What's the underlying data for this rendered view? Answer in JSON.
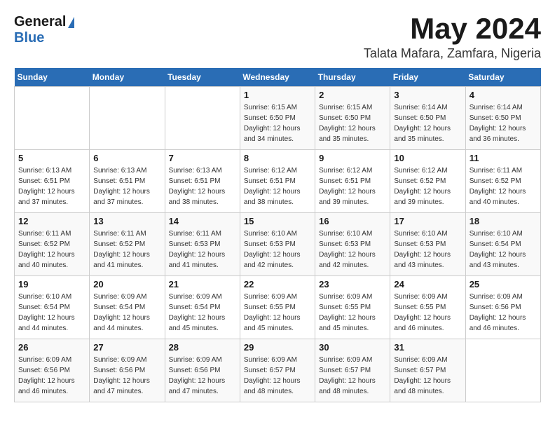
{
  "header": {
    "logo_general": "General",
    "logo_blue": "Blue",
    "month": "May 2024",
    "location": "Talata Mafara, Zamfara, Nigeria"
  },
  "days_of_week": [
    "Sunday",
    "Monday",
    "Tuesday",
    "Wednesday",
    "Thursday",
    "Friday",
    "Saturday"
  ],
  "weeks": [
    [
      {
        "day": "",
        "info": ""
      },
      {
        "day": "",
        "info": ""
      },
      {
        "day": "",
        "info": ""
      },
      {
        "day": "1",
        "info": "Sunrise: 6:15 AM\nSunset: 6:50 PM\nDaylight: 12 hours\nand 34 minutes."
      },
      {
        "day": "2",
        "info": "Sunrise: 6:15 AM\nSunset: 6:50 PM\nDaylight: 12 hours\nand 35 minutes."
      },
      {
        "day": "3",
        "info": "Sunrise: 6:14 AM\nSunset: 6:50 PM\nDaylight: 12 hours\nand 35 minutes."
      },
      {
        "day": "4",
        "info": "Sunrise: 6:14 AM\nSunset: 6:50 PM\nDaylight: 12 hours\nand 36 minutes."
      }
    ],
    [
      {
        "day": "5",
        "info": "Sunrise: 6:13 AM\nSunset: 6:51 PM\nDaylight: 12 hours\nand 37 minutes."
      },
      {
        "day": "6",
        "info": "Sunrise: 6:13 AM\nSunset: 6:51 PM\nDaylight: 12 hours\nand 37 minutes."
      },
      {
        "day": "7",
        "info": "Sunrise: 6:13 AM\nSunset: 6:51 PM\nDaylight: 12 hours\nand 38 minutes."
      },
      {
        "day": "8",
        "info": "Sunrise: 6:12 AM\nSunset: 6:51 PM\nDaylight: 12 hours\nand 38 minutes."
      },
      {
        "day": "9",
        "info": "Sunrise: 6:12 AM\nSunset: 6:51 PM\nDaylight: 12 hours\nand 39 minutes."
      },
      {
        "day": "10",
        "info": "Sunrise: 6:12 AM\nSunset: 6:52 PM\nDaylight: 12 hours\nand 39 minutes."
      },
      {
        "day": "11",
        "info": "Sunrise: 6:11 AM\nSunset: 6:52 PM\nDaylight: 12 hours\nand 40 minutes."
      }
    ],
    [
      {
        "day": "12",
        "info": "Sunrise: 6:11 AM\nSunset: 6:52 PM\nDaylight: 12 hours\nand 40 minutes."
      },
      {
        "day": "13",
        "info": "Sunrise: 6:11 AM\nSunset: 6:52 PM\nDaylight: 12 hours\nand 41 minutes."
      },
      {
        "day": "14",
        "info": "Sunrise: 6:11 AM\nSunset: 6:53 PM\nDaylight: 12 hours\nand 41 minutes."
      },
      {
        "day": "15",
        "info": "Sunrise: 6:10 AM\nSunset: 6:53 PM\nDaylight: 12 hours\nand 42 minutes."
      },
      {
        "day": "16",
        "info": "Sunrise: 6:10 AM\nSunset: 6:53 PM\nDaylight: 12 hours\nand 42 minutes."
      },
      {
        "day": "17",
        "info": "Sunrise: 6:10 AM\nSunset: 6:53 PM\nDaylight: 12 hours\nand 43 minutes."
      },
      {
        "day": "18",
        "info": "Sunrise: 6:10 AM\nSunset: 6:54 PM\nDaylight: 12 hours\nand 43 minutes."
      }
    ],
    [
      {
        "day": "19",
        "info": "Sunrise: 6:10 AM\nSunset: 6:54 PM\nDaylight: 12 hours\nand 44 minutes."
      },
      {
        "day": "20",
        "info": "Sunrise: 6:09 AM\nSunset: 6:54 PM\nDaylight: 12 hours\nand 44 minutes."
      },
      {
        "day": "21",
        "info": "Sunrise: 6:09 AM\nSunset: 6:54 PM\nDaylight: 12 hours\nand 45 minutes."
      },
      {
        "day": "22",
        "info": "Sunrise: 6:09 AM\nSunset: 6:55 PM\nDaylight: 12 hours\nand 45 minutes."
      },
      {
        "day": "23",
        "info": "Sunrise: 6:09 AM\nSunset: 6:55 PM\nDaylight: 12 hours\nand 45 minutes."
      },
      {
        "day": "24",
        "info": "Sunrise: 6:09 AM\nSunset: 6:55 PM\nDaylight: 12 hours\nand 46 minutes."
      },
      {
        "day": "25",
        "info": "Sunrise: 6:09 AM\nSunset: 6:56 PM\nDaylight: 12 hours\nand 46 minutes."
      }
    ],
    [
      {
        "day": "26",
        "info": "Sunrise: 6:09 AM\nSunset: 6:56 PM\nDaylight: 12 hours\nand 46 minutes."
      },
      {
        "day": "27",
        "info": "Sunrise: 6:09 AM\nSunset: 6:56 PM\nDaylight: 12 hours\nand 47 minutes."
      },
      {
        "day": "28",
        "info": "Sunrise: 6:09 AM\nSunset: 6:56 PM\nDaylight: 12 hours\nand 47 minutes."
      },
      {
        "day": "29",
        "info": "Sunrise: 6:09 AM\nSunset: 6:57 PM\nDaylight: 12 hours\nand 48 minutes."
      },
      {
        "day": "30",
        "info": "Sunrise: 6:09 AM\nSunset: 6:57 PM\nDaylight: 12 hours\nand 48 minutes."
      },
      {
        "day": "31",
        "info": "Sunrise: 6:09 AM\nSunset: 6:57 PM\nDaylight: 12 hours\nand 48 minutes."
      },
      {
        "day": "",
        "info": ""
      }
    ]
  ]
}
